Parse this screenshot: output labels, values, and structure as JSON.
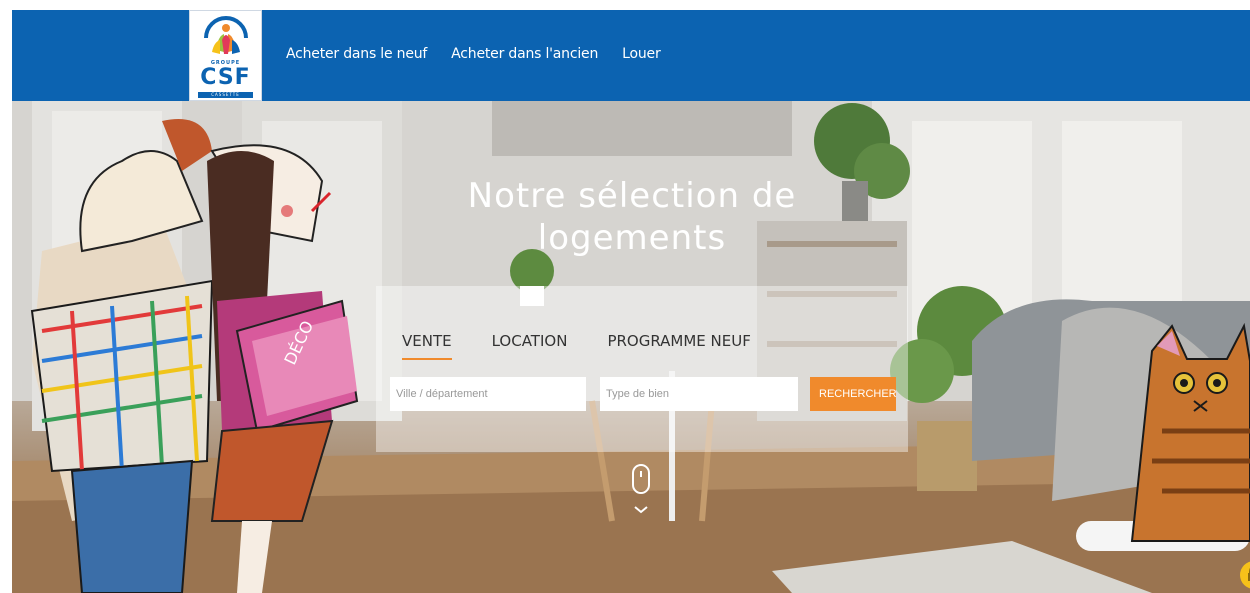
{
  "header": {
    "logo": {
      "groupe_text": "GROUPE",
      "brand_text": "CSF",
      "caisse_text": "CASSETTE"
    },
    "nav": [
      {
        "label": "Acheter dans le neuf"
      },
      {
        "label": "Acheter dans l'ancien"
      },
      {
        "label": "Louer"
      }
    ],
    "bar_color": "#0c63b1"
  },
  "hero": {
    "title": "Notre sélection de logements",
    "illustration_text": "DÉCO"
  },
  "search": {
    "tabs": [
      {
        "label": "VENTE",
        "active": true
      },
      {
        "label": "LOCATION",
        "active": false
      },
      {
        "label": "PROGRAMME NEUF",
        "active": false
      }
    ],
    "city_placeholder": "Ville / département",
    "type_placeholder": "Type de bien",
    "button_label": "RECHERCHER",
    "accent_color": "#f08a2c"
  },
  "icons": {
    "scroll": "mouse-scroll-icon",
    "badge": "lock-icon"
  }
}
